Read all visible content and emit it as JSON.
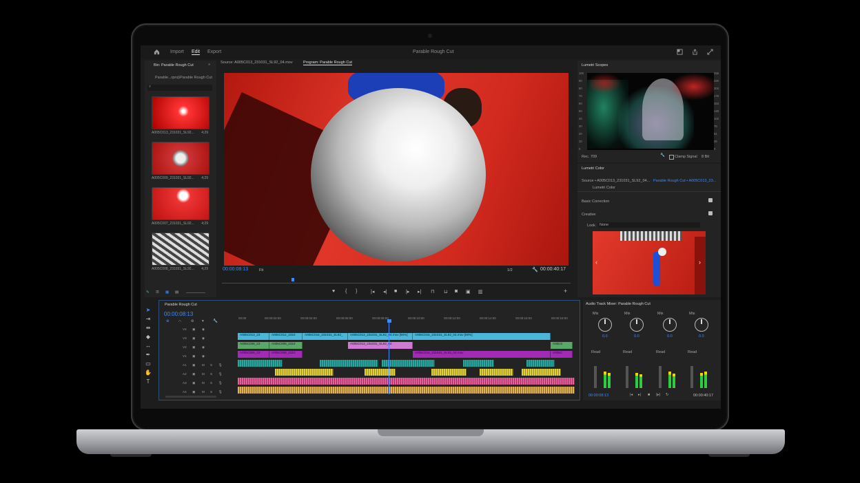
{
  "topbar": {
    "nav": [
      "Import",
      "Edit",
      "Export"
    ],
    "title": "Parable Rough Cut"
  },
  "project": {
    "tab": "Bin: Parable Rough Cut",
    "path": "Parable...rproj\\Parable Rough Cut",
    "clips": [
      {
        "name": "A005C013_231031_SL92...",
        "duration": "4;29"
      },
      {
        "name": "A005C009_231031_SL92...",
        "duration": "4;29"
      },
      {
        "name": "A005C007_231031_SL92...",
        "duration": "4;29"
      },
      {
        "name": "A005C008_231031_SL92...",
        "duration": "4;29"
      }
    ]
  },
  "monitor": {
    "source_tab": "Source: A005C013_231031_SL92_04.mov",
    "program_tab": "Program: Parable Rough Cut",
    "timecode": "00:00:08:13",
    "fit": "Fit",
    "resolution": "1/2",
    "duration": "00:00:40:17"
  },
  "scopes": {
    "title": "Lumetri Scopes",
    "rec": "Rec. 709",
    "clamp": "Clamp Signal",
    "bit": "8 Bit",
    "left_scale": [
      "100",
      "90",
      "80",
      "70",
      "60",
      "50",
      "40",
      "30",
      "20",
      "10",
      "0"
    ],
    "right_scale": [
      "255",
      "230",
      "204",
      "178",
      "153",
      "128",
      "102",
      "76",
      "51",
      "26",
      "0"
    ]
  },
  "lumetri": {
    "title": "Lumetri Color",
    "source": "Source • A005C013_231031_SL92_04...",
    "target": "Parable Rough Cut • A005C013_23...",
    "effect": "Lumetri Color",
    "basic": "Basic Correction",
    "creative": "Creative",
    "look_label": "Look",
    "look_value": "None"
  },
  "timeline": {
    "tab": "Parable Rough Cut",
    "timecode": "00:00:08:13",
    "ruler": [
      "00:00",
      "00:00:02:00",
      "00:00:04:00",
      "00:00:06:00",
      "00:00:08:00",
      "00:00:10:00",
      "00:00:12:00",
      "00:00:14:00",
      "00:00:16:00",
      "00:00:18:00"
    ],
    "video_tracks": [
      "V4",
      "V3",
      "V2",
      "V1"
    ],
    "audio_tracks": [
      "A1",
      "A2",
      "A3",
      "A4"
    ],
    "v3_clips": [
      "A005C013_23",
      "A005C012_2310",
      "A005C016_231031_SL92_",
      "A005C013_231031_SL92_04.mov [90%]",
      "A005C015_231031_SL92_04.mov [90%]"
    ],
    "v2_clips": [
      "A005C008_23",
      "A005C008_2310",
      "A005C013_231031_SL92_04",
      "A00C0"
    ],
    "v1_clips": [
      "A005C009_23",
      "A005C008_2310",
      "A005C016_231031_SL92_04.mov",
      "A005C"
    ]
  },
  "mixer": {
    "title": "Audio Track Mixer: Parable Rough Cut",
    "mix_labels": [
      "Mix",
      "Mix",
      "Mix",
      "Mix"
    ],
    "pan_values": [
      "0.0",
      "0.0",
      "0.0",
      "0.0"
    ],
    "read_labels": [
      "Read",
      "Read",
      "Read",
      "Read"
    ],
    "timecode": "00:00:08:13",
    "duration": "00:00:40:17"
  }
}
